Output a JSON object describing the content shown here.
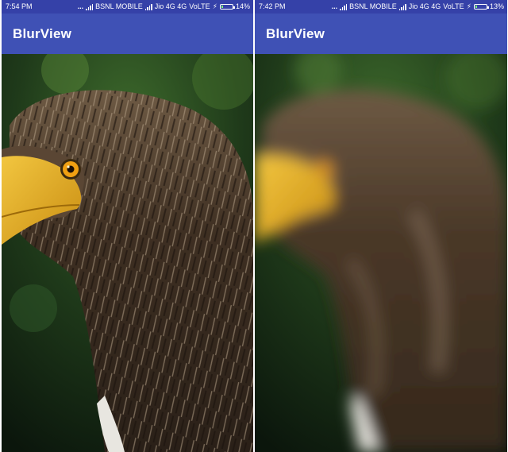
{
  "screens": [
    {
      "status": {
        "time": "7:54 PM",
        "carrier1": "BSNL MOBILE",
        "carrier2": "Jio 4G 4G",
        "volte": "VoLTE",
        "battery": "14%",
        "battery_level": 0.14
      },
      "app_title": "BlurView",
      "image": {
        "subject": "eagle-photo",
        "blurred": false
      }
    },
    {
      "status": {
        "time": "7:42 PM",
        "carrier1": "BSNL MOBILE",
        "carrier2": "Jio 4G 4G",
        "volte": "VoLTE",
        "battery": "13%",
        "battery_level": 0.13
      },
      "app_title": "BlurView",
      "image": {
        "subject": "eagle-photo",
        "blurred": true
      }
    }
  ],
  "colors": {
    "status_bar": "#3541a8",
    "app_bar": "#3f51b5",
    "beak": "#e8b52a",
    "eye": "#f0a012"
  },
  "icons": [
    "signal-icon",
    "lightning-icon",
    "battery-icon",
    "more-dots-icon"
  ]
}
